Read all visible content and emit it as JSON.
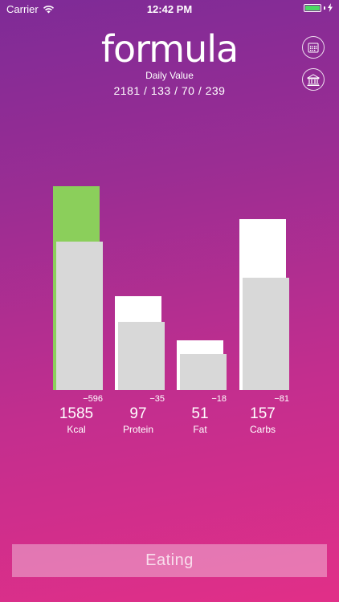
{
  "status_bar": {
    "carrier": "Carrier",
    "time": "12:42 PM"
  },
  "header": {
    "title": "formula",
    "daily_label": "Daily Value",
    "daily_values": "2181 / 133 / 70 / 239"
  },
  "icons": {
    "calendar": "calendar-icon",
    "bank": "bank-icon",
    "wifi": "wifi-icon",
    "battery": "battery-icon"
  },
  "colors": {
    "over_target": "#8bcf5b",
    "target": "#ffffff",
    "actual": "#d8d8d8"
  },
  "chart_data": {
    "type": "bar",
    "categories": [
      "Kcal",
      "Protein",
      "Fat",
      "Carbs"
    ],
    "series": [
      {
        "values": [
          2181,
          133,
          70,
          239
        ]
      },
      {
        "values": [
          1585,
          97,
          51,
          157
        ]
      }
    ],
    "value_labels": [
      "1585",
      "97",
      "51",
      "157"
    ],
    "diff_labels": [
      "−596",
      "−35",
      "−18",
      "−81"
    ]
  },
  "eating_button": {
    "label": "Eating"
  }
}
